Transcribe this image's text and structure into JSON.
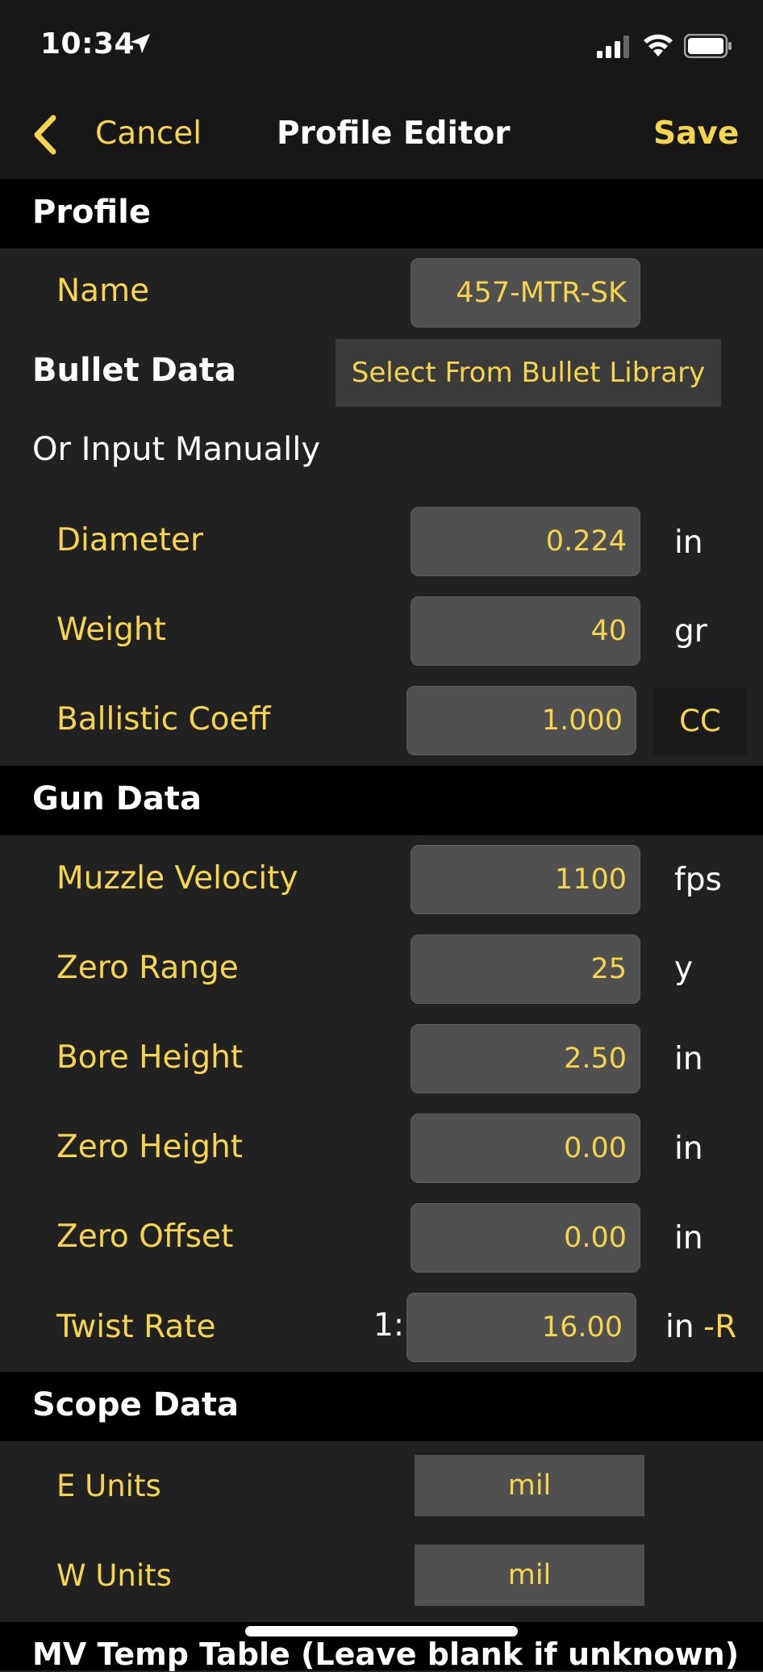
{
  "status_bar": {
    "time": "10:34"
  },
  "nav": {
    "back_label": "Cancel",
    "title": "Profile Editor",
    "save_label": "Save"
  },
  "profile": {
    "section_title": "Profile",
    "name_label": "Name",
    "name_value": "457-MTR-SK"
  },
  "bullet": {
    "section_title": "Bullet Data",
    "library_button": "Select From Bullet Library",
    "manual_label": "Or Input Manually",
    "diameter": {
      "label": "Diameter",
      "value": "0.224",
      "unit": "in"
    },
    "weight": {
      "label": "Weight",
      "value": "40",
      "unit": "gr"
    },
    "bc": {
      "label": "Ballistic Coeff",
      "value": "1.000",
      "unit": "CC"
    }
  },
  "gun": {
    "section_title": "Gun Data",
    "muzzle_velocity": {
      "label": "Muzzle Velocity",
      "value": "1100",
      "unit": "fps"
    },
    "zero_range": {
      "label": "Zero Range",
      "value": "25",
      "unit": "y"
    },
    "bore_height": {
      "label": "Bore Height",
      "value": "2.50",
      "unit": "in"
    },
    "zero_height": {
      "label": "Zero Height",
      "value": "0.00",
      "unit": "in"
    },
    "zero_offset": {
      "label": "Zero Offset",
      "value": "0.00",
      "unit": "in"
    },
    "twist_rate": {
      "label": "Twist Rate",
      "prefix": "1:",
      "value": "16.00",
      "unit": "in",
      "direction": "-R"
    }
  },
  "scope": {
    "section_title": "Scope Data",
    "e_units": {
      "label": "E Units",
      "value": "mil"
    },
    "w_units": {
      "label": "W Units",
      "value": "mil"
    }
  },
  "mv_table": {
    "section_title": "MV Temp Table (Leave blank if unknown)"
  },
  "colors": {
    "accent": "#f5d54e",
    "background": "#212121",
    "header": "#000000",
    "field": "#505050"
  }
}
